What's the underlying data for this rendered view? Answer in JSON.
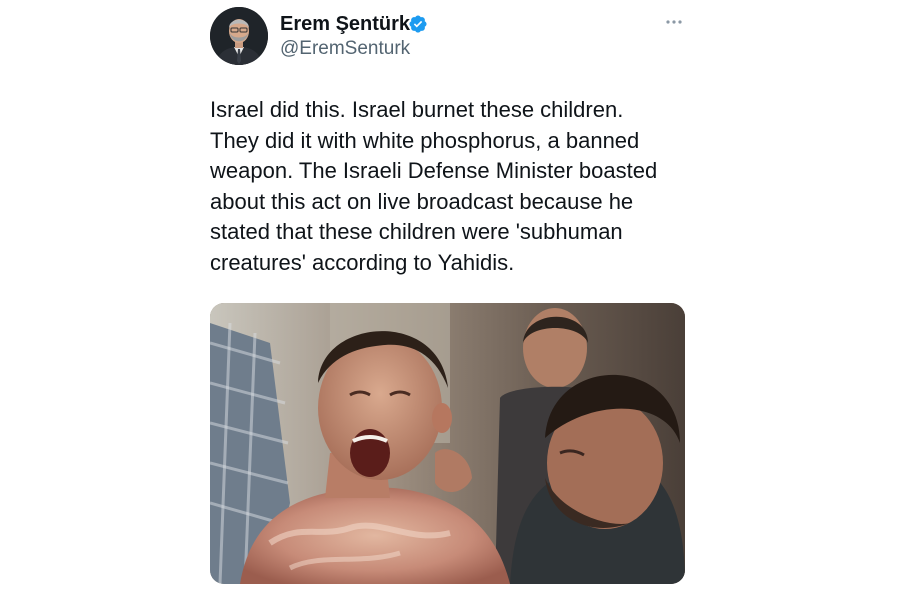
{
  "tweet": {
    "author": {
      "display_name": "Erem Şentürk",
      "handle": "@EremSenturk",
      "verified": true,
      "avatar_icon": "avatar-photo"
    },
    "menu_icon": "more-horizontal-icon",
    "text_lines": [
      "Israel did this. Israel burnet these children.",
      "They did it with white phosphorus, a banned",
      "weapon. The Israeli Defense Minister boasted",
      "about this act on live broadcast because he",
      "stated that these children were 'subhuman",
      "creatures' according to Yahidis."
    ],
    "media": {
      "type": "photo",
      "icon": "attached-photo"
    },
    "colors": {
      "verified_badge": "#1d9bf0",
      "handle_gray": "#536471",
      "text": "#0f1419"
    }
  }
}
